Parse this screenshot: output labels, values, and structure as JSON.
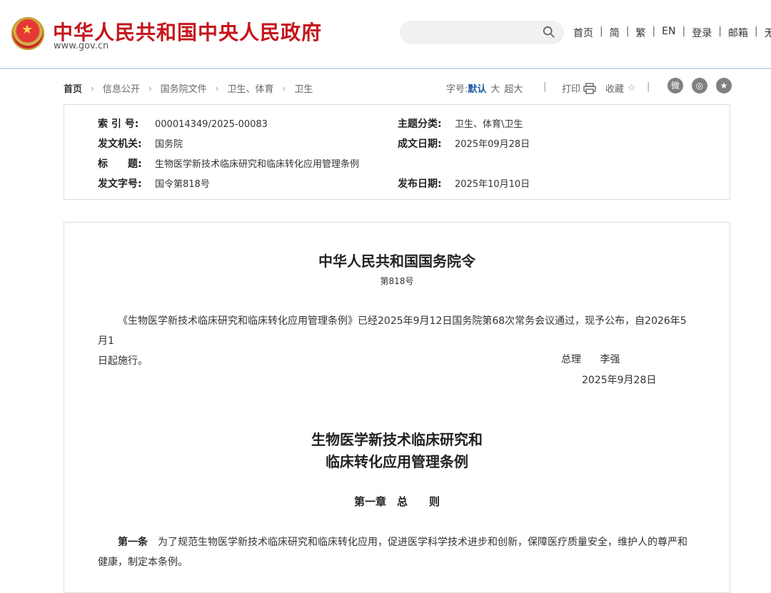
{
  "header": {
    "site_title": "中华人民共和国中央人民政府",
    "site_domain": "www.gov.cn",
    "nav": [
      "首页",
      "简",
      "繁",
      "EN",
      "登录",
      "邮箱",
      "无障"
    ]
  },
  "breadcrumb": [
    "首页",
    "信息公开",
    "国务院文件",
    "卫生、体育",
    "卫生"
  ],
  "toolbar": {
    "font_label": "字号:",
    "font_default": "默认",
    "font_large": "大",
    "font_xlarge": "超大",
    "print": "打印",
    "favorite": "收藏"
  },
  "meta": {
    "index_label": "索 引 号:",
    "index_value": "000014349/2025-00083",
    "topic_label": "主题分类:",
    "topic_value": "卫生、体育\\卫生",
    "issuer_label": "发文机关:",
    "issuer_value": "国务院",
    "created_label": "成文日期:",
    "created_value": "2025年09月28日",
    "title_label": "标　　题:",
    "title_value": "生物医学新技术临床研究和临床转化应用管理条例",
    "doc_no_label": "发文字号:",
    "doc_no_value": "国令第818号",
    "published_label": "发布日期:",
    "published_value": "2025年10月10日"
  },
  "document": {
    "order_title": "中华人民共和国国务院令",
    "order_no": "第818号",
    "intro_line1": "《生物医学新技术临床研究和临床转化应用管理条例》已经2025年9月12日国务院第68次常务会议通过，现予公布，自2026年5月1",
    "intro_line2": "日起施行。",
    "signer_title": "总理",
    "signer_name": "李强",
    "sign_date": "2025年9月28日",
    "reg_title_1": "生物医学新技术临床研究和",
    "reg_title_2": "临床转化应用管理条例",
    "chapter": "第一章　总　　则",
    "article_label": "第一条",
    "article_line1": "为了规范生物医学新技术临床研究和临床转化应用，促进医学科学技术进步和创新，保障医疗质量安全，维护人的尊严和",
    "article_line2": "健康，制定本条例。"
  }
}
